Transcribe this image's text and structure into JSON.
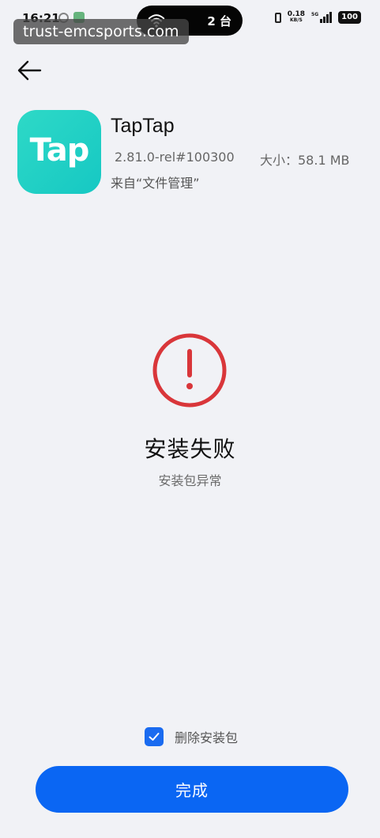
{
  "status_bar": {
    "time": "16:21",
    "island_text": "2 台",
    "net_speed": "0.18",
    "net_speed_unit": "KB/S",
    "network_type": "5G",
    "battery": "100"
  },
  "watermark": "trust-emcsports.com",
  "app": {
    "name": "TapTap",
    "icon_text": "Tap",
    "version": "2.81.0-rel#100300",
    "size": "大小：58.1 MB",
    "source": "来自“文件管理”",
    "icon_color": "#1fd1c4"
  },
  "result": {
    "title": "安装失败",
    "reason": "安装包异常",
    "icon_color": "#d9363a"
  },
  "delete_package": {
    "label": "删除安装包",
    "checked": true
  },
  "done_button": {
    "label": "完成",
    "color": "#0a66f3"
  },
  "icons": {
    "back": "arrow-left-icon",
    "error": "exclamation-circle-icon",
    "check": "checkmark-icon"
  }
}
